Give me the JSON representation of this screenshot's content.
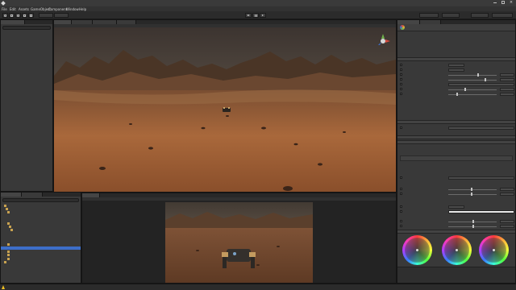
{
  "window": {
    "title": ""
  },
  "menubar": {
    "items": [
      "File",
      "Edit",
      "Assets",
      "GameObject",
      "Component",
      "Window",
      "Help"
    ]
  },
  "toolbar": {
    "account_label": "",
    "layers_label": "",
    "layout_label": "",
    "collab_label": "",
    "pivot_label": "",
    "local_label": ""
  },
  "hierarchy": {
    "tab_label": "",
    "rows": [
      "",
      "",
      "",
      ""
    ]
  },
  "project": {
    "tabs": [
      "",
      ""
    ],
    "rows": [
      "",
      "",
      "",
      "",
      "",
      "",
      "",
      "",
      "",
      "",
      "",
      "",
      "",
      "",
      "",
      "",
      "",
      "",
      "",
      "",
      "",
      ""
    ]
  },
  "scene": {
    "tabs": [
      "",
      "",
      "",
      ""
    ],
    "gizmo_label": ""
  },
  "game": {
    "tab_label": "",
    "toolbar_labels": [
      "",
      "",
      ""
    ]
  },
  "inspector": {
    "tabs": [
      "",
      ""
    ],
    "profile_name": "",
    "sections": [
      "",
      "",
      "",
      "",
      "",
      "",
      "",
      ""
    ],
    "bottom_bar": {
      "name": "",
      "values": [
        "",
        ""
      ]
    }
  },
  "status": {
    "message": ""
  },
  "colors": {
    "accent": "#3d6ec9",
    "panel": "#393939",
    "sky_top": "#3c3430",
    "sand": "#a6653a",
    "warning": "#f0c020",
    "color_wheel": "conic"
  },
  "icons": [
    "unity-logo-icon",
    "hand-tool-icon",
    "move-tool-icon",
    "rotate-tool-icon",
    "scale-tool-icon",
    "rect-tool-icon",
    "play-icon",
    "pause-icon",
    "step-icon",
    "scene-gizmo-icon",
    "warning-icon",
    "folder-icon",
    "color-wheel-icon"
  ]
}
